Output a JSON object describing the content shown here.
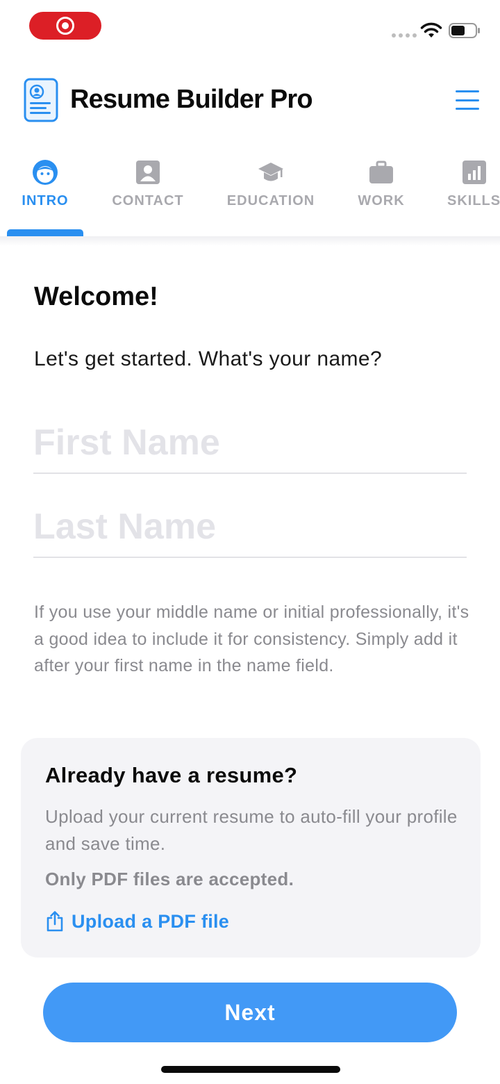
{
  "status_bar": {
    "recording_icon": "record-icon",
    "signal_icon": "signal-icon",
    "wifi_icon": "wifi-icon",
    "battery_icon": "battery-icon",
    "recording_color": "#dc1f26"
  },
  "header": {
    "title": "Resume Builder Pro",
    "logo_icon": "resume-document-icon",
    "menu_icon": "hamburger-menu-icon"
  },
  "tabs": [
    {
      "label": "INTRO",
      "icon": "face-icon",
      "active": true
    },
    {
      "label": "CONTACT",
      "icon": "contact-card-icon",
      "active": false
    },
    {
      "label": "EDUCATION",
      "icon": "graduation-cap-icon",
      "active": false
    },
    {
      "label": "WORK",
      "icon": "briefcase-icon",
      "active": false
    },
    {
      "label": "SKILLS",
      "icon": "bar-chart-icon",
      "active": false
    }
  ],
  "main": {
    "title": "Welcome!",
    "prompt": "Let's get started. What's your name?",
    "first_name": {
      "value": "",
      "placeholder": "First Name"
    },
    "last_name": {
      "value": "",
      "placeholder": "Last Name"
    },
    "hint": "If you use your middle name or initial professionally, it's a good idea to include it for consistency. Simply add it after your first name in the name field."
  },
  "upload_card": {
    "title": "Already have a resume?",
    "body": "Upload your current resume to auto-fill your profile and save time.",
    "note": "Only PDF files are accepted.",
    "link_label": "Upload a PDF file",
    "link_icon": "share-upload-icon"
  },
  "footer": {
    "next_label": "Next"
  },
  "colors": {
    "accent": "#2a8ff0",
    "button": "#4299f6",
    "inactive_tab": "#a9a9ae",
    "muted_text": "#8a8a8f",
    "card_bg": "#f4f4f7"
  }
}
